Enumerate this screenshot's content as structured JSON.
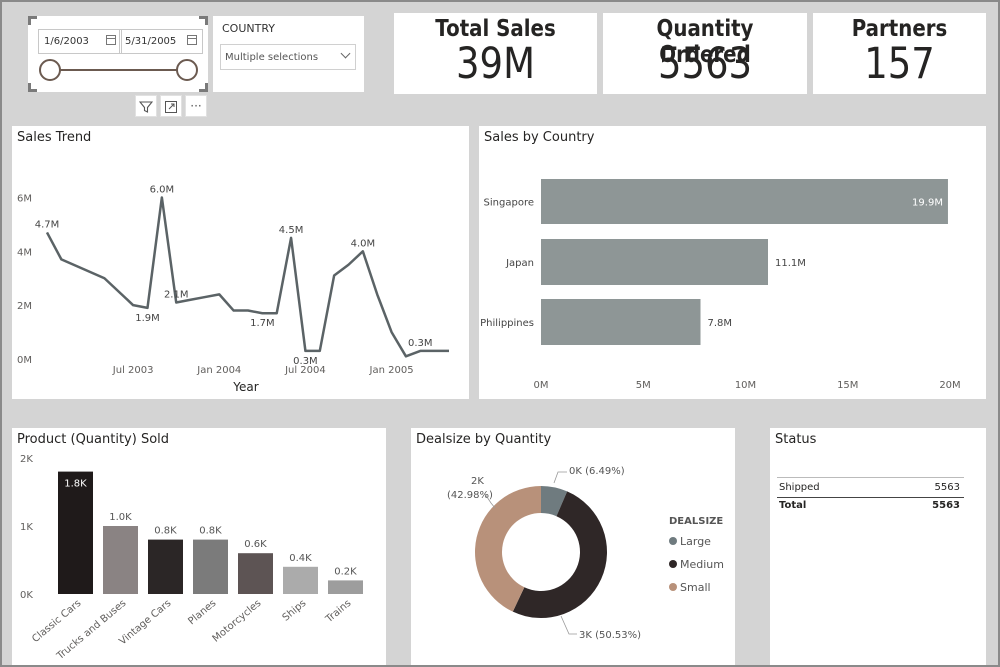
{
  "slicer": {
    "start_date": "1/6/2003",
    "end_date": "5/31/2005",
    "country_label": "COUNTRY",
    "country_value": "Multiple selections"
  },
  "kpis": {
    "total_sales": {
      "label": "Total Sales",
      "value": "39M"
    },
    "quantity": {
      "label": "Quantity Ordered",
      "value": "5563"
    },
    "partners": {
      "label": "Partners",
      "value": "157"
    }
  },
  "icons": [
    "filter-icon",
    "focus-mode-icon",
    "more-options-icon",
    "calendar-icon",
    "chevron-down-icon"
  ],
  "colors": {
    "trend_line": "#5b6366",
    "country_bar": "#8e9696",
    "large": "#6f7b7f",
    "medium": "#2f2727",
    "small": "#b8917a"
  },
  "sales_trend": {
    "title": "Sales Trend",
    "chart_data": {
      "type": "line",
      "xlabel": "Year",
      "ylabel": "",
      "x_ticks": [
        "Jul 2003",
        "Jan 2004",
        "Jul 2004",
        "Jan 2005"
      ],
      "y_ticks": [
        "0M",
        "2M",
        "4M",
        "6M"
      ],
      "ylim": [
        0,
        6.5
      ],
      "x": [
        "2003-01",
        "2003-02",
        "2003-05",
        "2003-07",
        "2003-08",
        "2003-09",
        "2003-10",
        "2003-11",
        "2003-12",
        "2004-01",
        "2004-02",
        "2004-03",
        "2004-04",
        "2004-05",
        "2004-06",
        "2004-07",
        "2004-08",
        "2004-09",
        "2004-10",
        "2004-11",
        "2004-12",
        "2005-01",
        "2005-02",
        "2005-03",
        "2005-04",
        "2005-05"
      ],
      "values": [
        4.7,
        3.7,
        3.0,
        2.0,
        1.9,
        6.0,
        2.1,
        2.2,
        2.3,
        2.4,
        1.8,
        1.8,
        1.7,
        1.7,
        4.5,
        0.3,
        0.3,
        3.1,
        3.5,
        4.0,
        2.4,
        1.0,
        0.1,
        0.3,
        0.3,
        0.3
      ],
      "point_labels": [
        {
          "index": 0,
          "text": "4.7M"
        },
        {
          "index": 4,
          "text": "1.9M"
        },
        {
          "index": 5,
          "text": "6.0M"
        },
        {
          "index": 6,
          "text": "2.1M"
        },
        {
          "index": 12,
          "text": "1.7M"
        },
        {
          "index": 14,
          "text": "4.5M"
        },
        {
          "index": 15,
          "text": "0.3M"
        },
        {
          "index": 19,
          "text": "4.0M"
        },
        {
          "index": 23,
          "text": "0.3M"
        }
      ]
    }
  },
  "sales_by_country": {
    "title": "Sales by Country",
    "chart_data": {
      "type": "bar",
      "orientation": "horizontal",
      "categories": [
        "Singapore",
        "Japan",
        "Philippines"
      ],
      "values": [
        19.9,
        11.1,
        7.8
      ],
      "data_labels": [
        "19.9M",
        "11.1M",
        "7.8M"
      ],
      "x_ticks": [
        "0M",
        "5M",
        "10M",
        "15M",
        "20M"
      ],
      "xlim": [
        0,
        20
      ]
    }
  },
  "product_sold": {
    "title": "Product (Quantity) Sold",
    "chart_data": {
      "type": "bar",
      "categories": [
        "Classic Cars",
        "Trucks and Buses",
        "Vintage Cars",
        "Planes",
        "Motorcycles",
        "Ships",
        "Trains"
      ],
      "values": [
        1.8,
        1.0,
        0.8,
        0.8,
        0.6,
        0.4,
        0.2
      ],
      "data_labels": [
        "1.8K",
        "1.0K",
        "0.8K",
        "0.8K",
        "0.6K",
        "0.4K",
        "0.2K"
      ],
      "bar_colors": [
        "#1f1a1a",
        "#8a8383",
        "#2b2626",
        "#7b7b7b",
        "#5d5454",
        "#ababab",
        "#9d9d9d"
      ],
      "y_ticks": [
        "0K",
        "1K",
        "2K"
      ],
      "ylim": [
        0,
        2
      ]
    }
  },
  "dealsize": {
    "title": "Dealsize by Quantity",
    "chart_data": {
      "type": "pie",
      "donut": true,
      "categories": [
        "Large",
        "Medium",
        "Small"
      ],
      "values": [
        6.49,
        50.53,
        42.98
      ],
      "slice_labels": [
        "0K (6.49%)",
        "3K (50.53%)",
        "2K (42.98%)"
      ],
      "legend_title": "DEALSIZE",
      "legend_position": "right"
    }
  },
  "status": {
    "title": "Status",
    "rows": [
      {
        "label": "Shipped",
        "value": "5563"
      }
    ],
    "total": {
      "label": "Total",
      "value": "5563"
    }
  }
}
